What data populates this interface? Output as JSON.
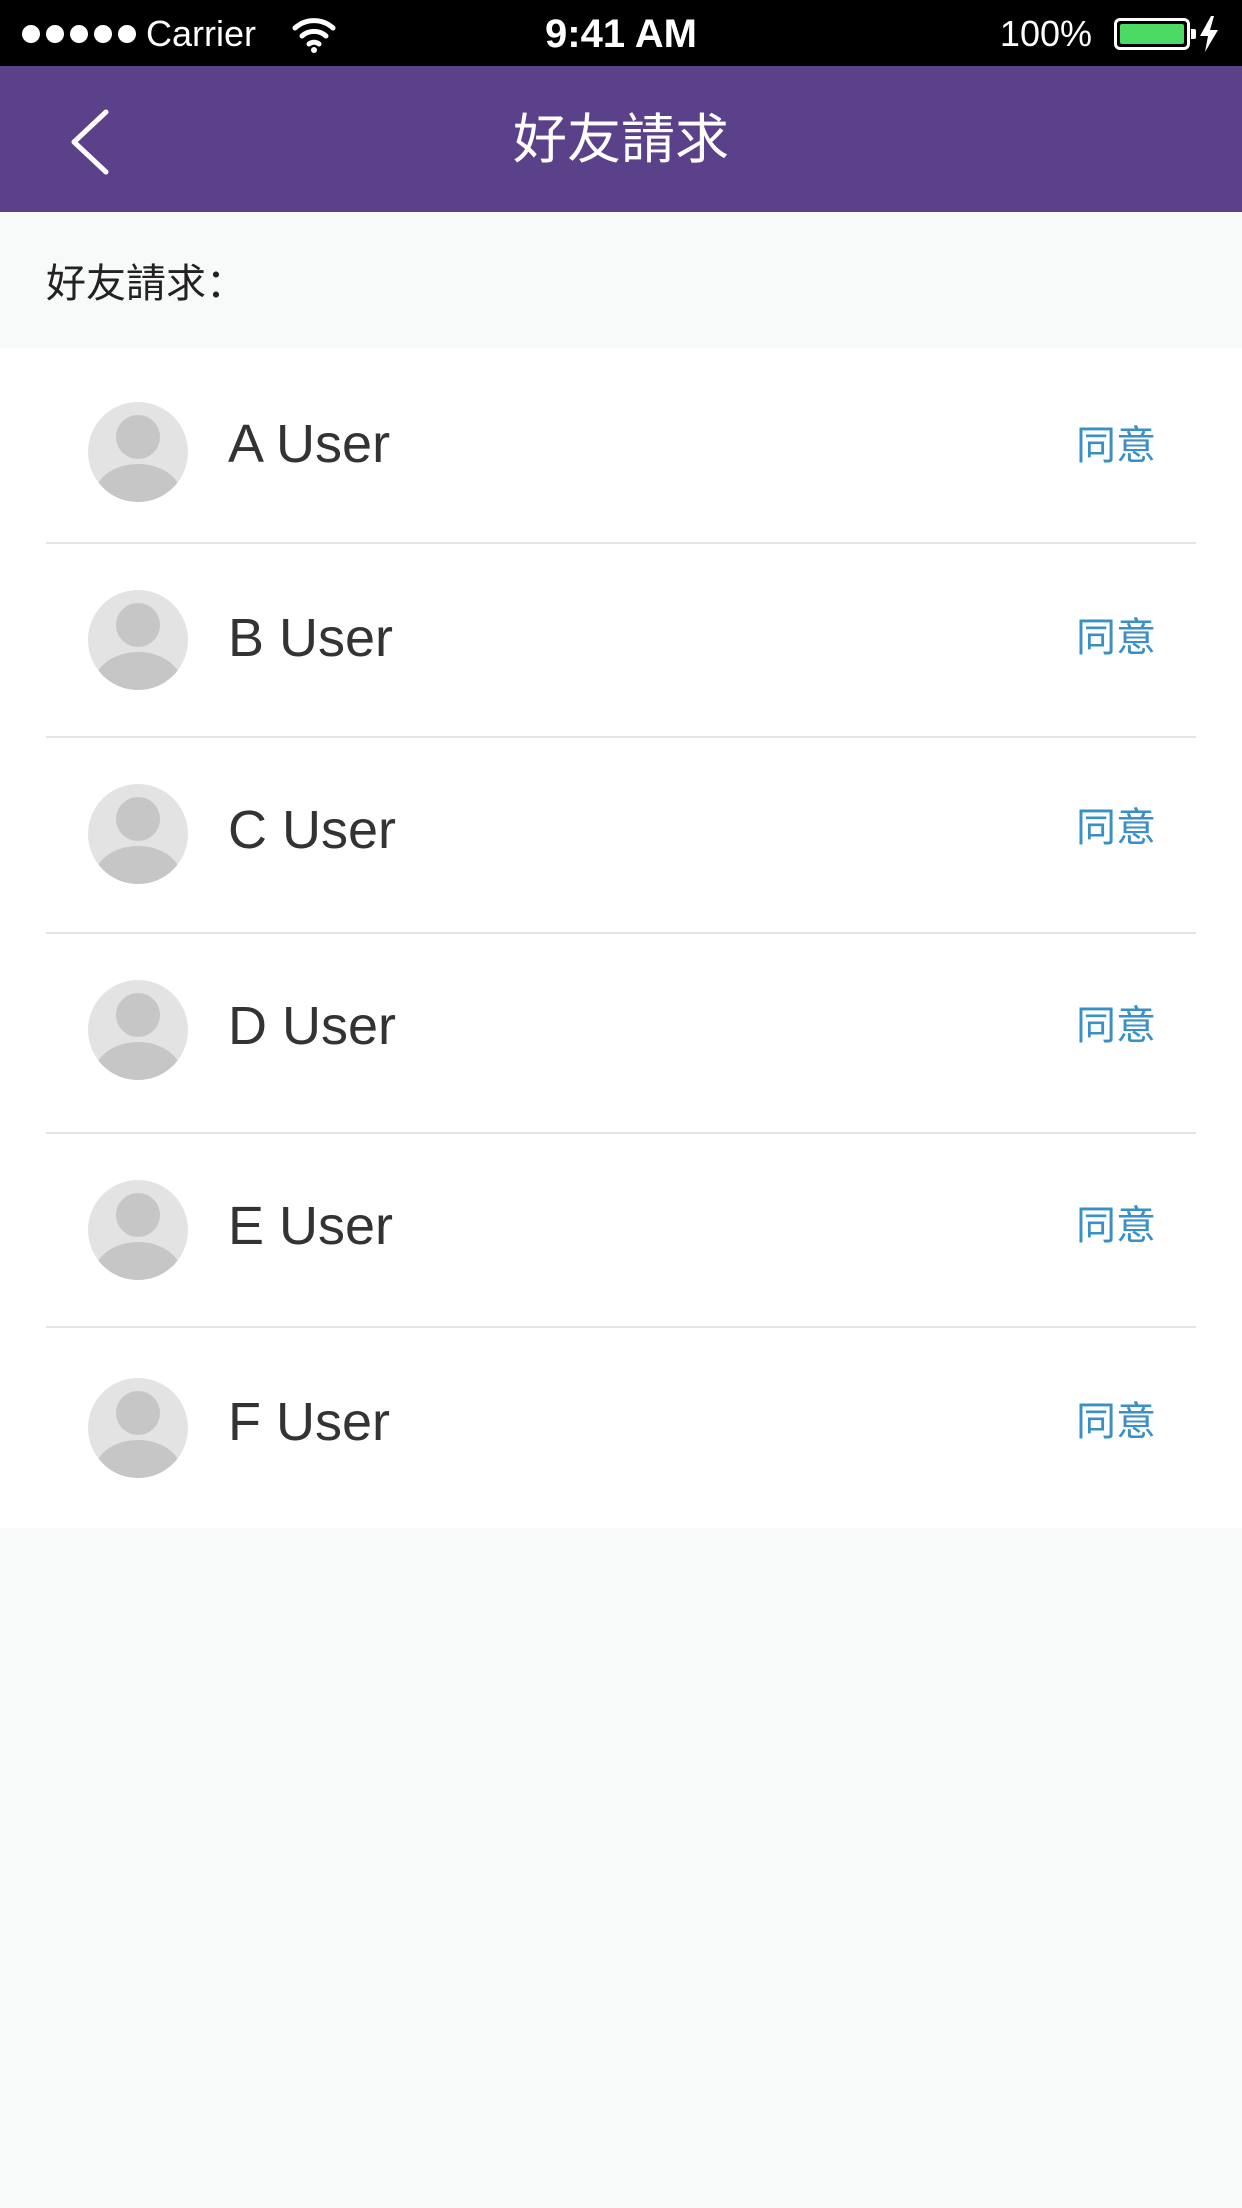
{
  "status_bar": {
    "carrier": "Carrier",
    "time": "9:41 AM",
    "battery": "100%",
    "battery_color": "#4cd964"
  },
  "nav": {
    "title": "好友請求",
    "back_icon": "chevron-left-icon",
    "background": "#5a4189"
  },
  "section": {
    "title": "好友請求："
  },
  "requests": [
    {
      "name": "A User",
      "action": "同意"
    },
    {
      "name": "B User",
      "action": "同意"
    },
    {
      "name": "C User",
      "action": "同意"
    },
    {
      "name": "D User",
      "action": "同意"
    },
    {
      "name": "E User",
      "action": "同意"
    },
    {
      "name": "F User",
      "action": "同意"
    }
  ],
  "colors": {
    "accent": "#3a8fc7",
    "text": "#333333"
  }
}
